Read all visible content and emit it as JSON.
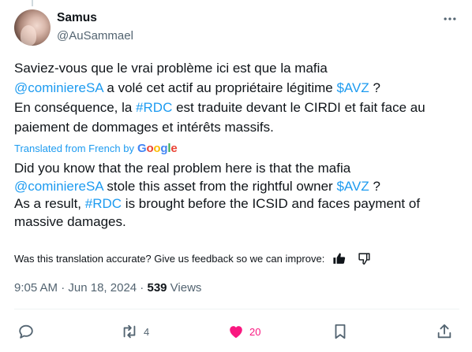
{
  "author": {
    "name": "Samus",
    "handle": "@AuSammael"
  },
  "tweet": {
    "original": {
      "p1": "Saviez-vous que le vrai problème ici est que la mafia",
      "mention": "@cominiereSA",
      "p2": " a volé cet actif au propriétaire légitime ",
      "cashtag": "$AVZ",
      "p3": " ?",
      "p4": "En conséquence, la ",
      "hashtag": "#RDC",
      "p5": " est traduite devant le CIRDI et fait face au paiement de dommages et intérêts massifs."
    },
    "translated_label": "Translated from French by",
    "translated_by": "Google",
    "translation": {
      "p1": "Did you know that the real problem here is that the mafia",
      "mention": "@cominiereSA",
      "p2": " stole this asset from the rightful owner ",
      "cashtag": "$AVZ",
      "p3": " ?",
      "p4": "As a result, ",
      "hashtag": "#RDC",
      "p5": " is brought before the ICSID and faces payment of massive damages."
    },
    "feedback_prompt": "Was this translation accurate? Give us feedback so we can improve:"
  },
  "meta": {
    "time": "9:05 AM",
    "separator1": " · ",
    "date": "Jun 18, 2024",
    "separator2": " · ",
    "views_count": "539",
    "views_label": " Views"
  },
  "actions": {
    "retweets": "4",
    "likes": "20"
  },
  "colors": {
    "link": "#1d9bf0",
    "like": "#f91880",
    "muted": "#536471",
    "text": "#0f1419"
  },
  "icons": {
    "more": "more-icon",
    "thumbs_up": "thumbs-up-icon",
    "thumbs_down": "thumbs-down-icon",
    "reply": "reply-icon",
    "retweet": "retweet-icon",
    "like": "heart-icon",
    "bookmark": "bookmark-icon",
    "share": "share-icon"
  }
}
